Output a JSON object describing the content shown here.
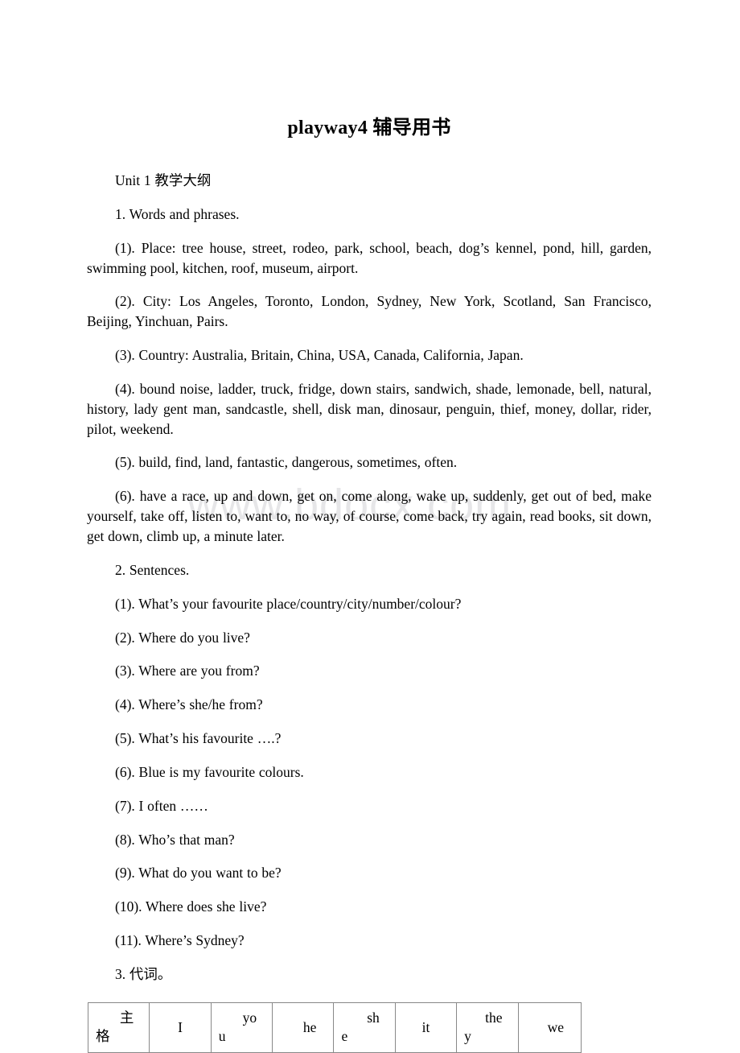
{
  "document": {
    "title": "playway4 辅导用书",
    "watermark": "www.bdocx.com"
  },
  "body": {
    "unit_heading": "Unit 1 教学大纲",
    "section1_heading": "1. Words and phrases.",
    "words": [
      "(1). Place: tree house, street, rodeo, park, school, beach, dog’s kennel, pond, hill, garden, swimming pool, kitchen, roof, museum, airport.",
      "(2). City: Los Angeles, Toronto, London, Sydney, New York, Scotland, San Francisco, Beijing, Yinchuan, Pairs.",
      "(3). Country: Australia, Britain, China, USA, Canada, California, Japan.",
      "(4). bound noise, ladder, truck, fridge, down stairs, sandwich, shade, lemonade, bell, natural, history, lady gent man, sandcastle, shell, disk man, dinosaur, penguin, thief, money, dollar, rider, pilot, weekend.",
      "(5). build, find, land, fantastic, dangerous, sometimes, often.",
      "(6). have a race, up and down, get on, come along, wake up, suddenly, get out of bed, make yourself, take off, listen to, want to, no way, of course, come back, try again, read books, sit down, get down, climb up, a minute later."
    ],
    "section2_heading": "2. Sentences.",
    "sentences": [
      "(1). What’s your favourite place/country/city/number/colour?",
      "(2). Where do you live?",
      "(3). Where are you from?",
      "(4). Where’s she/he from?",
      "(5). What’s his favourite ….?",
      "(6). Blue is my favourite colours.",
      "(7). I often ……",
      "(8). Who’s that man?",
      "(9). What do you want to be?",
      "(10). Where does she live?",
      "(11). Where’s Sydney?"
    ],
    "section3_heading": "3. 代词。"
  },
  "pronoun_table": {
    "rows": [
      {
        "header": {
          "line1": "主",
          "line2": "格"
        },
        "cells": [
          {
            "line1": "I",
            "line2": ""
          },
          {
            "line1": "yo",
            "line2": "u"
          },
          {
            "line1": "he",
            "line2": ""
          },
          {
            "line1": "sh",
            "line2": "e"
          },
          {
            "line1": "it",
            "line2": ""
          },
          {
            "line1": "the",
            "line2": "y"
          },
          {
            "line1": "we",
            "line2": ""
          }
        ]
      }
    ]
  }
}
